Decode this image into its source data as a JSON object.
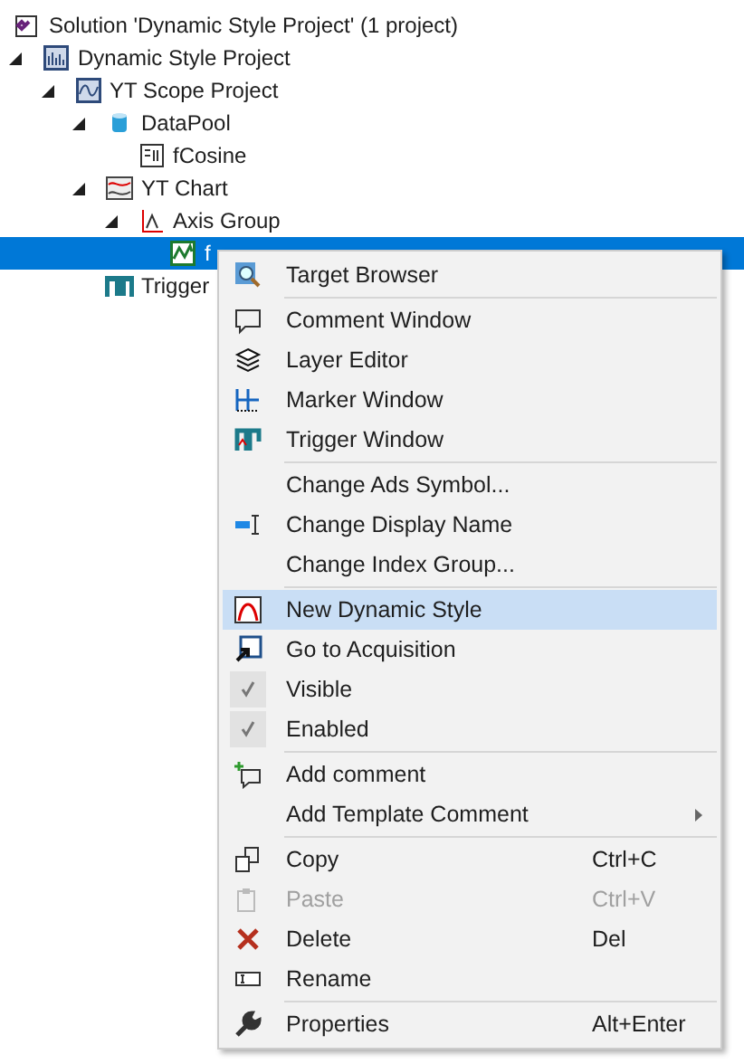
{
  "solution": {
    "label": "Solution 'Dynamic Style Project' (1 project)"
  },
  "tree": [
    {
      "label": "Dynamic Style Project",
      "expanded": true,
      "selected": false,
      "children": [
        {
          "label": "YT Scope Project",
          "expanded": true,
          "selected": false,
          "children": [
            {
              "label": "DataPool",
              "expanded": true,
              "selected": false,
              "children": [
                {
                  "label": "fCosine",
                  "selected": false
                }
              ]
            },
            {
              "label": "YT Chart",
              "expanded": true,
              "selected": false,
              "children": [
                {
                  "label": "Axis Group",
                  "expanded": true,
                  "selected": false,
                  "children": [
                    {
                      "label": "f",
                      "selected": true
                    }
                  ]
                }
              ]
            },
            {
              "label": "Trigger",
              "selected": false
            }
          ]
        }
      ]
    }
  ],
  "context_menu": {
    "groups": [
      [
        {
          "label": "Target Browser",
          "selected": false,
          "disabled": false,
          "checked": false
        }
      ],
      [
        {
          "label": "Comment Window",
          "selected": false,
          "disabled": false,
          "checked": false
        },
        {
          "label": "Layer Editor",
          "selected": false,
          "disabled": false,
          "checked": false
        },
        {
          "label": "Marker Window",
          "selected": false,
          "disabled": false,
          "checked": false
        },
        {
          "label": "Trigger Window",
          "selected": false,
          "disabled": false,
          "checked": false
        }
      ],
      [
        {
          "label": "Change Ads Symbol...",
          "selected": false,
          "disabled": false,
          "checked": false
        },
        {
          "label": "Change Display Name",
          "selected": false,
          "disabled": false,
          "checked": false
        },
        {
          "label": "Change Index Group...",
          "selected": false,
          "disabled": false,
          "checked": false
        }
      ],
      [
        {
          "label": "New Dynamic Style",
          "selected": true,
          "disabled": false,
          "checked": false
        },
        {
          "label": "Go to Acquisition",
          "selected": false,
          "disabled": false,
          "checked": false
        },
        {
          "label": "Visible",
          "selected": false,
          "disabled": false,
          "checked": true
        },
        {
          "label": "Enabled",
          "selected": false,
          "disabled": false,
          "checked": true
        }
      ],
      [
        {
          "label": "Add comment",
          "selected": false,
          "disabled": false,
          "checked": false
        },
        {
          "label": "Add Template Comment",
          "selected": false,
          "disabled": false,
          "checked": false,
          "submenu": true
        }
      ],
      [
        {
          "label": "Copy",
          "shortcut": "Ctrl+C",
          "selected": false,
          "disabled": false,
          "checked": false
        },
        {
          "label": "Paste",
          "shortcut": "Ctrl+V",
          "selected": false,
          "disabled": true,
          "checked": false
        },
        {
          "label": "Delete",
          "shortcut": "Del",
          "selected": false,
          "disabled": false,
          "checked": false
        },
        {
          "label": "Rename",
          "selected": false,
          "disabled": false,
          "checked": false
        }
      ],
      [
        {
          "label": "Properties",
          "shortcut": "Alt+Enter",
          "selected": false,
          "disabled": false,
          "checked": false
        }
      ]
    ]
  }
}
